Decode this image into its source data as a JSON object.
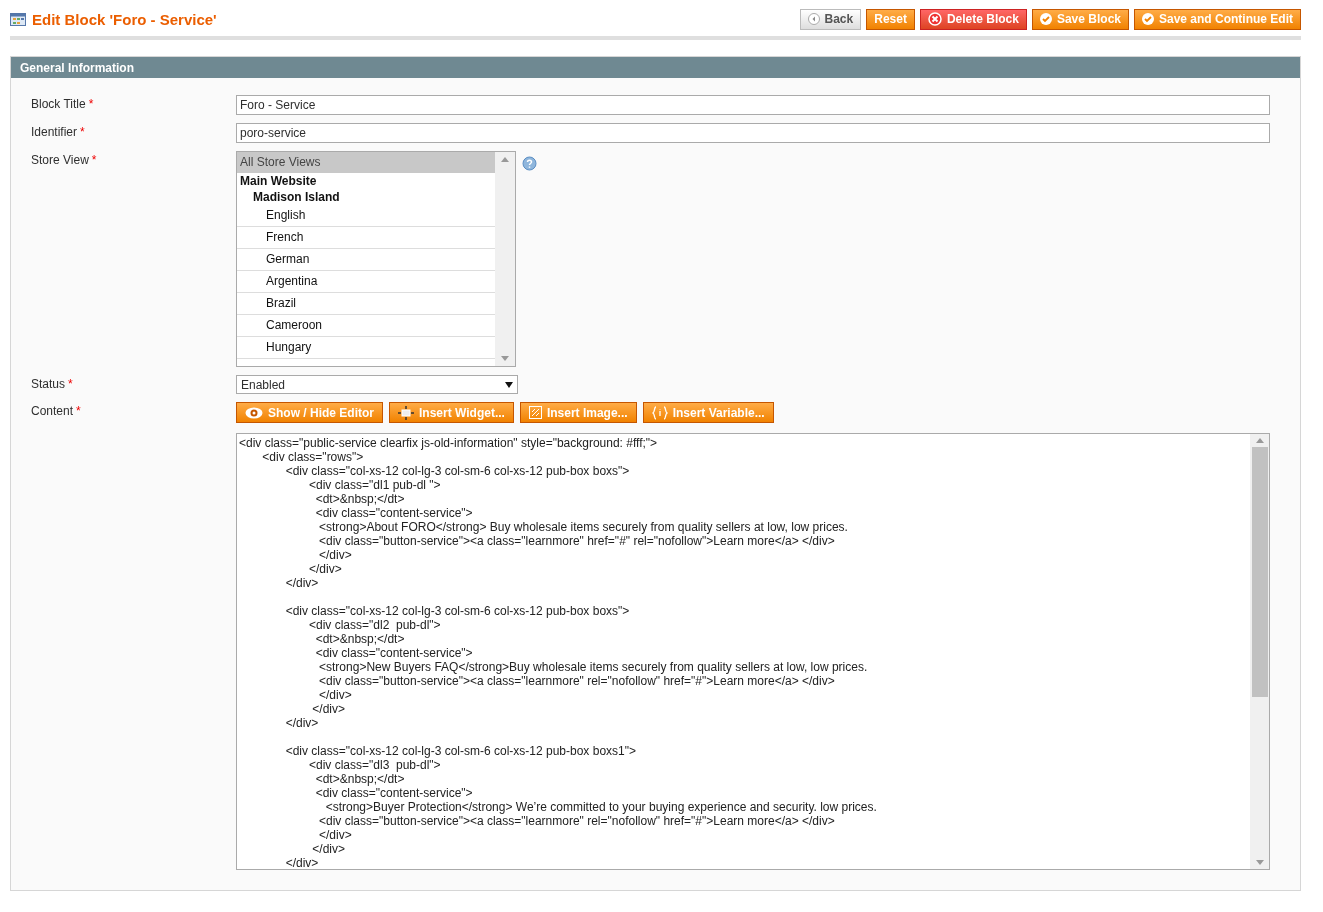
{
  "header": {
    "title": "Edit Block 'Foro - Service'",
    "buttons": [
      {
        "label": "Back",
        "kind": "back"
      },
      {
        "label": "Reset",
        "kind": "plain"
      },
      {
        "label": "Delete Block",
        "kind": "delete"
      },
      {
        "label": "Save Block",
        "kind": "save"
      },
      {
        "label": "Save and Continue Edit",
        "kind": "save"
      }
    ]
  },
  "section": {
    "title": "General Information",
    "fields": [
      {
        "label": "Block Title",
        "required_mark": "*",
        "kind": "text",
        "value": "Foro - Service"
      },
      {
        "label": "Identifier",
        "required_mark": "*",
        "kind": "text",
        "value": "poro-service"
      },
      {
        "label": "Store View",
        "required_mark": "*",
        "kind": "multiselect",
        "options": [
          {
            "label": "All Store Views",
            "selected": true
          },
          {
            "label": "Main Website",
            "selected": false,
            "children": [
              {
                "label": "Madison Island",
                "selected": false,
                "children": [
                  {
                    "label": "English",
                    "selected": false
                  },
                  {
                    "label": "French",
                    "selected": false
                  },
                  {
                    "label": "German",
                    "selected": false
                  },
                  {
                    "label": "Argentina",
                    "selected": false
                  },
                  {
                    "label": "Brazil",
                    "selected": false
                  },
                  {
                    "label": "Cameroon",
                    "selected": false
                  },
                  {
                    "label": "Hungary",
                    "selected": false
                  }
                ]
              }
            ]
          }
        ]
      },
      {
        "label": "Status",
        "required_mark": "*",
        "kind": "select",
        "value": "Enabled"
      },
      {
        "label": "Content",
        "required_mark": "*",
        "kind": "editor",
        "buttons": [
          {
            "label": "Show / Hide Editor",
            "kind": "eye"
          },
          {
            "label": "Insert Widget...",
            "kind": "widget"
          },
          {
            "label": "Insert Image...",
            "kind": "image"
          },
          {
            "label": "Insert Variable...",
            "kind": "variable"
          }
        ],
        "code_blocks": [
          [
            "<div class=\"public-service clearfix js-old-information\" style=\"background: #fff;\">",
            "       <div class=\"rows\">",
            "              <div class=\"col-xs-12 col-lg-3 col-sm-6 col-xs-12 pub-box boxs\">",
            "                     <div class=\"dl1 pub-dl \">",
            "                       <dt>&nbsp;</dt>",
            "                       <div class=\"content-service\">",
            "                        <strong>About FORO</strong> Buy wholesale items securely from quality sellers at low, low prices.",
            "                        <div class=\"button-service\"><a class=\"learnmore\" href=\"#\" rel=\"nofollow\">Learn more</a> </div>",
            "                        </div>",
            "                     </div>",
            "              </div>"
          ],
          [
            "              <div class=\"col-xs-12 col-lg-3 col-sm-6 col-xs-12 pub-box boxs\">",
            "                     <div class=\"dl2  pub-dl\">",
            "                       <dt>&nbsp;</dt>",
            "                       <div class=\"content-service\">",
            "                        <strong>New Buyers FAQ</strong>Buy wholesale items securely from quality sellers at low, low prices.",
            "                        <div class=\"button-service\"><a class=\"learnmore\" rel=\"nofollow\" href=\"#\">Learn more</a> </div>",
            "                        </div>",
            "                      </div>",
            "              </div>"
          ],
          [
            "              <div class=\"col-xs-12 col-lg-3 col-sm-6 col-xs-12 pub-box boxs1\">",
            "                     <div class=\"dl3  pub-dl\">",
            "                       <dt>&nbsp;</dt>",
            "                       <div class=\"content-service\">",
            "                          <strong>Buyer Protection</strong> We’re committed to your buying experience and security. low prices.",
            "                        <div class=\"button-service\"><a class=\"learnmore\" rel=\"nofollow\" href=\"#\">Learn more</a> </div>",
            "                        </div>",
            "                      </div>",
            "              </div>"
          ]
        ]
      }
    ]
  }
}
